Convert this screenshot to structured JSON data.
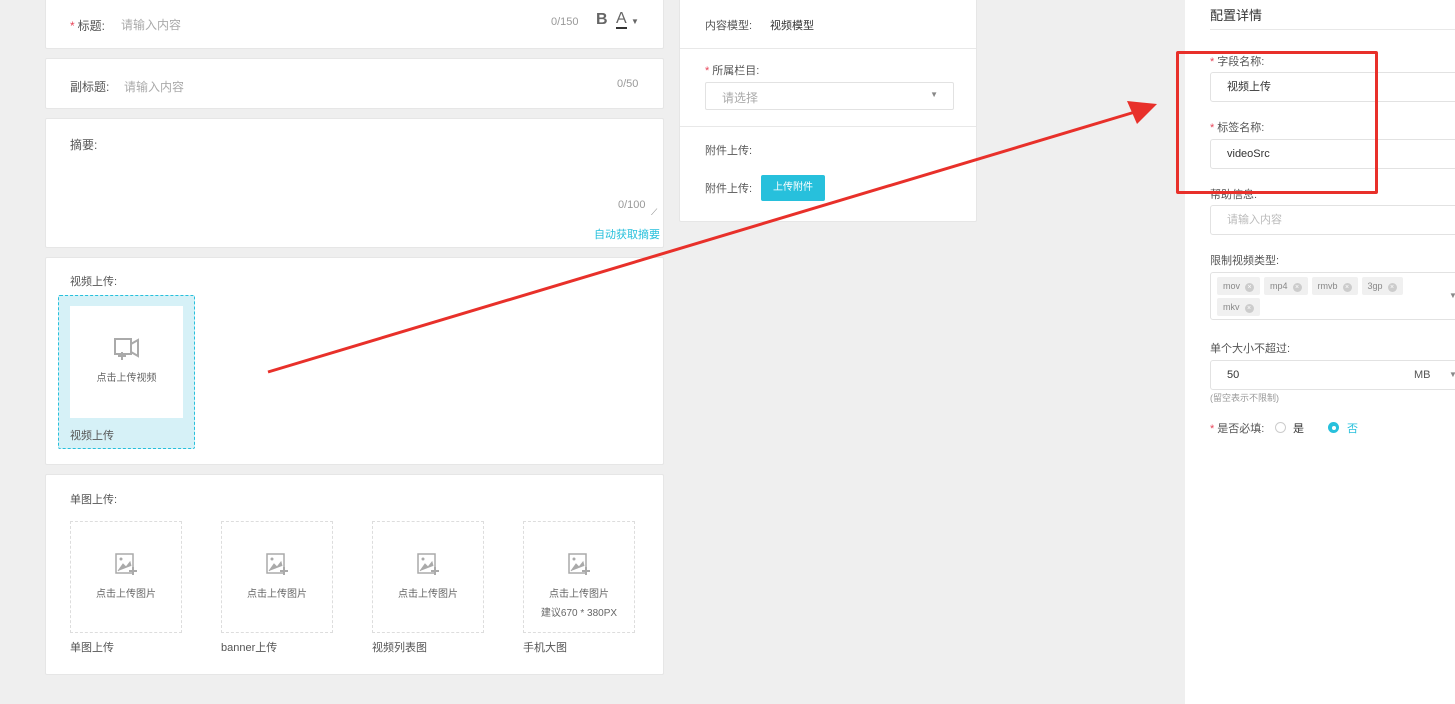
{
  "title_field": {
    "label": "标题:",
    "placeholder": "请输入内容",
    "count": "0/150",
    "bold": "B",
    "color": "A"
  },
  "subtitle_field": {
    "label": "副标题:",
    "placeholder": "请输入内容",
    "count": "0/50"
  },
  "summary_field": {
    "label": "摘要:",
    "count": "0/100",
    "auto_link": "自动获取摘要"
  },
  "video_upload": {
    "label": "视频上传:",
    "button_text": "点击上传视频",
    "caption": "视频上传"
  },
  "image_upload": {
    "label": "单图上传:",
    "items": [
      {
        "text": "点击上传图片",
        "hint": "",
        "caption": "单图上传"
      },
      {
        "text": "点击上传图片",
        "hint": "",
        "caption": "banner上传"
      },
      {
        "text": "点击上传图片",
        "hint": "",
        "caption": "视频列表图"
      },
      {
        "text": "点击上传图片",
        "hint": "建议670 * 380PX",
        "caption": "手机大图"
      }
    ]
  },
  "side": {
    "model_label": "内容模型:",
    "model_value": "视频模型",
    "column_label": "所属栏目:",
    "column_placeholder": "请选择",
    "attach_title": "附件上传:",
    "attach_label": "附件上传:",
    "attach_button": "上传附件"
  },
  "config": {
    "title": "配置详情",
    "field_name_label": "字段名称:",
    "field_name_value": "视频上传",
    "tag_name_label": "标签名称:",
    "tag_name_value": "videoSrc",
    "help_label": "帮助信息:",
    "help_placeholder": "请输入内容",
    "types_label": "限制视频类型:",
    "types": [
      "mov",
      "mp4",
      "rmvb",
      "3gp",
      "mkv"
    ],
    "size_label": "单个大小不超过:",
    "size_value": "50",
    "size_unit": "MB",
    "size_hint": "(留空表示不限制)",
    "required_label": "是否必填:",
    "required_yes": "是",
    "required_no": "否",
    "required_selected": "否"
  },
  "colors": {
    "accent": "#27c0dc",
    "annotation": "#e8302a",
    "required": "#e8465a"
  }
}
